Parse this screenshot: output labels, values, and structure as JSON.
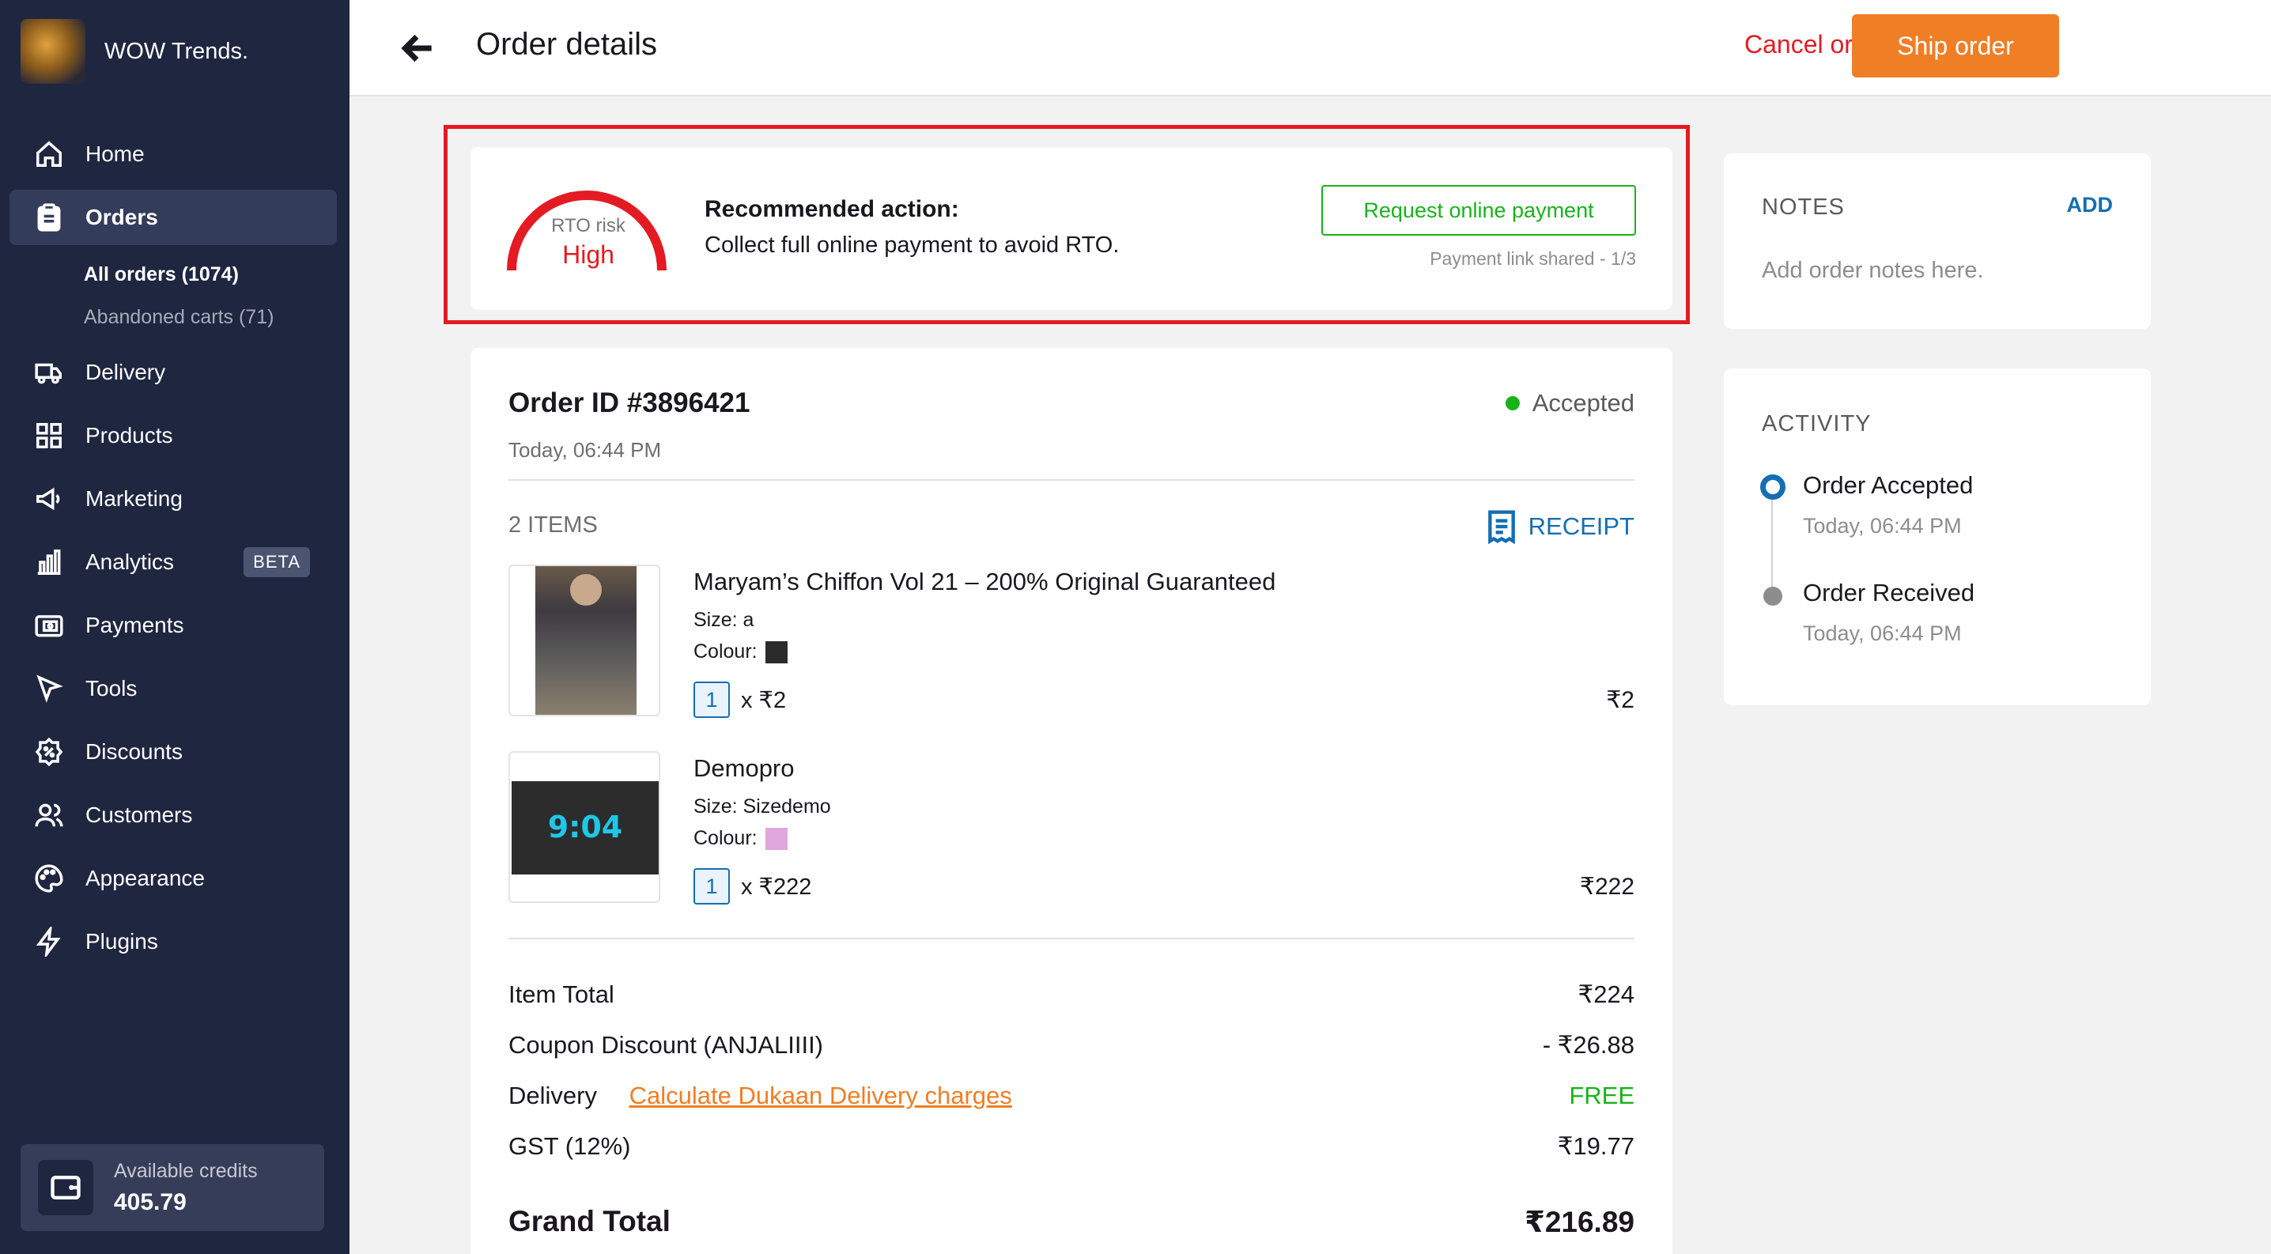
{
  "brand": {
    "name": "WOW Trends."
  },
  "sidebar": {
    "items": [
      {
        "label": "Home",
        "icon": "home-icon"
      },
      {
        "label": "Orders",
        "icon": "clipboard-icon"
      },
      {
        "label": "Delivery",
        "icon": "truck-icon"
      },
      {
        "label": "Products",
        "icon": "grid-icon"
      },
      {
        "label": "Marketing",
        "icon": "megaphone-icon"
      },
      {
        "label": "Analytics",
        "icon": "bar-chart-icon",
        "badge": "BETA"
      },
      {
        "label": "Payments",
        "icon": "wallet-icon"
      },
      {
        "label": "Tools",
        "icon": "cursor-icon"
      },
      {
        "label": "Discounts",
        "icon": "discount-icon"
      },
      {
        "label": "Customers",
        "icon": "users-icon"
      },
      {
        "label": "Appearance",
        "icon": "palette-icon"
      },
      {
        "label": "Plugins",
        "icon": "lightning-icon"
      }
    ],
    "orders_sub": [
      {
        "label": "All orders (1074)"
      },
      {
        "label": "Abandoned carts (71)"
      }
    ],
    "credits": {
      "label": "Available credits",
      "value": "405.79"
    }
  },
  "header": {
    "title": "Order details",
    "cancel_label": "Cancel order",
    "ship_label": "Ship order"
  },
  "rto": {
    "gauge_label": "RTO risk",
    "risk_level": "High",
    "rec_title": "Recommended action:",
    "rec_text": "Collect full online payment to avoid RTO.",
    "button_label": "Request online payment",
    "link_shared": "Payment link shared - 1/3",
    "accent": "#e31b23"
  },
  "order": {
    "id_label": "Order ID #3896421",
    "date": "Today, 06:44 PM",
    "status": "Accepted",
    "items_count": "2 ITEMS",
    "receipt_label": "RECEIPT",
    "items": [
      {
        "name": "Maryam’s Chiffon Vol 21 –  200% Original Guaranteed",
        "size": "Size: a",
        "colour_label": "Colour:",
        "colour": "#2b2b2b",
        "qty": "1",
        "unit_price": "x ₹2",
        "price": "₹2"
      },
      {
        "name": "Demopro",
        "size": "Size: Sizedemo",
        "colour_label": "Colour:",
        "colour": "#e0a6de",
        "qty": "1",
        "unit_price": "x ₹222",
        "price": "₹222",
        "thumb_text": "9:04"
      }
    ],
    "summary": {
      "item_total_label": "Item Total",
      "item_total": "₹224",
      "coupon_label": "Coupon Discount (ANJALIIII)",
      "coupon": "- ₹26.88",
      "delivery_label": "Delivery",
      "delivery_link": "Calculate Dukaan Delivery charges",
      "delivery": "FREE",
      "gst_label": "GST (12%)",
      "gst": "₹19.77",
      "grand_label": "Grand Total",
      "grand": "₹216.89"
    }
  },
  "notes": {
    "title": "NOTES",
    "add_label": "ADD",
    "placeholder": "Add order notes here."
  },
  "activity": {
    "title": "ACTIVITY",
    "events": [
      {
        "title": "Order Accepted",
        "date": "Today, 06:44 PM"
      },
      {
        "title": "Order Received",
        "date": "Today, 06:44 PM"
      }
    ]
  }
}
